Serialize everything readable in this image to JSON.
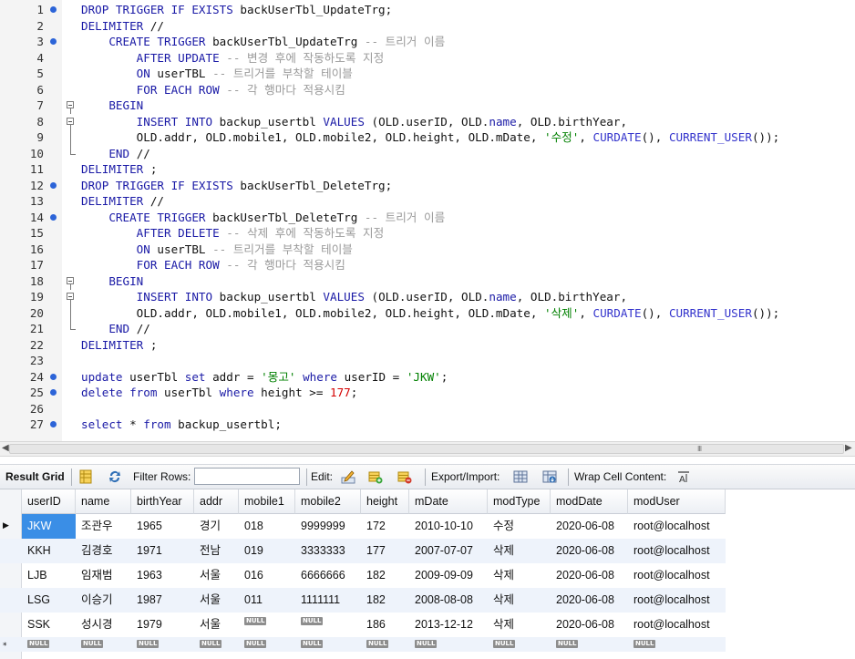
{
  "editor": {
    "lines": [
      {
        "n": "1",
        "bm": true,
        "fold": "",
        "tokens": [
          [
            "kw",
            "DROP TRIGGER IF EXISTS "
          ],
          [
            "pl",
            "backUserTbl_UpdateTrg;"
          ]
        ]
      },
      {
        "n": "2",
        "bm": false,
        "fold": "",
        "tokens": [
          [
            "kw",
            "DELIMITER "
          ],
          [
            "pl",
            "//"
          ]
        ]
      },
      {
        "n": "3",
        "bm": true,
        "fold": "",
        "tokens": [
          [
            "pl",
            "    "
          ],
          [
            "kw",
            "CREATE TRIGGER "
          ],
          [
            "pl",
            "backUserTbl_UpdateTrg "
          ],
          [
            "cm",
            "-- 트리거 이름"
          ]
        ]
      },
      {
        "n": "4",
        "bm": false,
        "fold": "",
        "tokens": [
          [
            "pl",
            "        "
          ],
          [
            "kw",
            "AFTER UPDATE "
          ],
          [
            "cm",
            "-- 변경 후에 작동하도록 지정"
          ]
        ]
      },
      {
        "n": "5",
        "bm": false,
        "fold": "",
        "tokens": [
          [
            "pl",
            "        "
          ],
          [
            "kw",
            "ON "
          ],
          [
            "pl",
            "userTBL "
          ],
          [
            "cm",
            "-- 트리거를 부착할 테이블"
          ]
        ]
      },
      {
        "n": "6",
        "bm": false,
        "fold": "",
        "tokens": [
          [
            "pl",
            "        "
          ],
          [
            "kw",
            "FOR EACH ROW "
          ],
          [
            "cm",
            "-- 각 행마다 적용시킴"
          ]
        ]
      },
      {
        "n": "7",
        "bm": false,
        "fold": "box",
        "tokens": [
          [
            "pl",
            "    "
          ],
          [
            "kw",
            "BEGIN"
          ]
        ]
      },
      {
        "n": "8",
        "bm": false,
        "fold": "box",
        "tokens": [
          [
            "pl",
            "        "
          ],
          [
            "kw",
            "INSERT INTO "
          ],
          [
            "pl",
            "backup_usertbl "
          ],
          [
            "kw",
            "VALUES "
          ],
          [
            "pl",
            "(OLD.userID, OLD."
          ],
          [
            "kw",
            "name"
          ],
          [
            "pl",
            ", OLD.birthYear,"
          ]
        ]
      },
      {
        "n": "9",
        "bm": false,
        "fold": "end",
        "tokens": [
          [
            "pl",
            "        OLD.addr, OLD.mobile1, OLD.mobile2, OLD.height, OLD.mDate, "
          ],
          [
            "st",
            "'수정'"
          ],
          [
            "pl",
            ", "
          ],
          [
            "fn",
            "CURDATE"
          ],
          [
            "pl",
            "(), "
          ],
          [
            "fn",
            "CURRENT_USER"
          ],
          [
            "pl",
            "());"
          ]
        ]
      },
      {
        "n": "10",
        "bm": false,
        "fold": "end2",
        "tokens": [
          [
            "pl",
            "    "
          ],
          [
            "kw",
            "END "
          ],
          [
            "pl",
            "//"
          ]
        ]
      },
      {
        "n": "11",
        "bm": false,
        "fold": "",
        "tokens": [
          [
            "kw",
            "DELIMITER "
          ],
          [
            "pl",
            ";"
          ]
        ]
      },
      {
        "n": "12",
        "bm": true,
        "fold": "",
        "tokens": [
          [
            "kw",
            "DROP TRIGGER IF EXISTS "
          ],
          [
            "pl",
            "backUserTbl_DeleteTrg;"
          ]
        ]
      },
      {
        "n": "13",
        "bm": false,
        "fold": "",
        "tokens": [
          [
            "kw",
            "DELIMITER "
          ],
          [
            "pl",
            "//"
          ]
        ]
      },
      {
        "n": "14",
        "bm": true,
        "fold": "",
        "tokens": [
          [
            "pl",
            "    "
          ],
          [
            "kw",
            "CREATE TRIGGER "
          ],
          [
            "pl",
            "backUserTbl_DeleteTrg "
          ],
          [
            "cm",
            "-- 트리거 이름"
          ]
        ]
      },
      {
        "n": "15",
        "bm": false,
        "fold": "",
        "tokens": [
          [
            "pl",
            "        "
          ],
          [
            "kw",
            "AFTER DELETE "
          ],
          [
            "cm",
            "-- 삭제 후에 작동하도록 지정"
          ]
        ]
      },
      {
        "n": "16",
        "bm": false,
        "fold": "",
        "tokens": [
          [
            "pl",
            "        "
          ],
          [
            "kw",
            "ON "
          ],
          [
            "pl",
            "userTBL "
          ],
          [
            "cm",
            "-- 트리거를 부착할 테이블"
          ]
        ]
      },
      {
        "n": "17",
        "bm": false,
        "fold": "",
        "tokens": [
          [
            "pl",
            "        "
          ],
          [
            "kw",
            "FOR EACH ROW "
          ],
          [
            "cm",
            "-- 각 행마다 적용시킴"
          ]
        ]
      },
      {
        "n": "18",
        "bm": false,
        "fold": "box",
        "tokens": [
          [
            "pl",
            "    "
          ],
          [
            "kw",
            "BEGIN"
          ]
        ]
      },
      {
        "n": "19",
        "bm": false,
        "fold": "box",
        "tokens": [
          [
            "pl",
            "        "
          ],
          [
            "kw",
            "INSERT INTO "
          ],
          [
            "pl",
            "backup_usertbl "
          ],
          [
            "kw",
            "VALUES "
          ],
          [
            "pl",
            "(OLD.userID, OLD."
          ],
          [
            "kw",
            "name"
          ],
          [
            "pl",
            ", OLD.birthYear,"
          ]
        ]
      },
      {
        "n": "20",
        "bm": false,
        "fold": "end",
        "tokens": [
          [
            "pl",
            "        OLD.addr, OLD.mobile1, OLD.mobile2, OLD.height, OLD.mDate, "
          ],
          [
            "st",
            "'삭제'"
          ],
          [
            "pl",
            ", "
          ],
          [
            "fn",
            "CURDATE"
          ],
          [
            "pl",
            "(), "
          ],
          [
            "fn",
            "CURRENT_USER"
          ],
          [
            "pl",
            "());"
          ]
        ]
      },
      {
        "n": "21",
        "bm": false,
        "fold": "end2",
        "tokens": [
          [
            "pl",
            "    "
          ],
          [
            "kw",
            "END "
          ],
          [
            "pl",
            "//"
          ]
        ]
      },
      {
        "n": "22",
        "bm": false,
        "fold": "",
        "tokens": [
          [
            "kw",
            "DELIMITER "
          ],
          [
            "pl",
            ";"
          ]
        ]
      },
      {
        "n": "23",
        "bm": false,
        "fold": "",
        "tokens": []
      },
      {
        "n": "24",
        "bm": true,
        "fold": "",
        "tokens": [
          [
            "kw",
            "update "
          ],
          [
            "pl",
            "userTbl "
          ],
          [
            "kw",
            "set "
          ],
          [
            "pl",
            "addr = "
          ],
          [
            "st",
            "'몽고' "
          ],
          [
            "kw",
            "where "
          ],
          [
            "pl",
            "userID = "
          ],
          [
            "st",
            "'JKW'"
          ],
          [
            "pl",
            ";"
          ]
        ]
      },
      {
        "n": "25",
        "bm": true,
        "fold": "",
        "tokens": [
          [
            "kw",
            "delete from "
          ],
          [
            "pl",
            "userTbl "
          ],
          [
            "kw",
            "where "
          ],
          [
            "pl",
            "height >= "
          ],
          [
            "nm",
            "177"
          ],
          [
            "pl",
            ";"
          ]
        ]
      },
      {
        "n": "26",
        "bm": false,
        "fold": "",
        "tokens": []
      },
      {
        "n": "27",
        "bm": true,
        "fold": "",
        "tokens": [
          [
            "kw",
            "select "
          ],
          [
            "pl",
            "* "
          ],
          [
            "kw",
            "from "
          ],
          [
            "pl",
            "backup_usertbl;"
          ]
        ]
      }
    ],
    "scroll_grip": "III"
  },
  "toolbar": {
    "title": "Result Grid",
    "filter_label": "Filter Rows:",
    "filter_value": "",
    "edit_label": "Edit:",
    "export_label": "Export/Import:",
    "wrap_label": "Wrap Cell Content:"
  },
  "grid": {
    "columns": [
      "userID",
      "name",
      "birthYear",
      "addr",
      "mobile1",
      "mobile2",
      "height",
      "mDate",
      "modType",
      "modDate",
      "modUser"
    ],
    "rows": [
      [
        "JKW",
        "조관우",
        "1965",
        "경기",
        "018",
        "9999999",
        "172",
        "2010-10-10",
        "수정",
        "2020-06-08",
        "root@localhost"
      ],
      [
        "KKH",
        "김경호",
        "1971",
        "전남",
        "019",
        "3333333",
        "177",
        "2007-07-07",
        "삭제",
        "2020-06-08",
        "root@localhost"
      ],
      [
        "LJB",
        "임재범",
        "1963",
        "서울",
        "016",
        "6666666",
        "182",
        "2009-09-09",
        "삭제",
        "2020-06-08",
        "root@localhost"
      ],
      [
        "LSG",
        "이승기",
        "1987",
        "서울",
        "011",
        "1111111",
        "182",
        "2008-08-08",
        "삭제",
        "2020-06-08",
        "root@localhost"
      ],
      [
        "SSK",
        "성시경",
        "1979",
        "서울",
        "NULL",
        "NULL",
        "186",
        "2013-12-12",
        "삭제",
        "2020-06-08",
        "root@localhost"
      ],
      [
        "NULL",
        "NULL",
        "NULL",
        "NULL",
        "NULL",
        "NULL",
        "NULL",
        "NULL",
        "NULL",
        "NULL",
        "NULL"
      ]
    ],
    "null_text": "NULL",
    "current_row_marker": "▶",
    "new_row_marker": "*"
  }
}
